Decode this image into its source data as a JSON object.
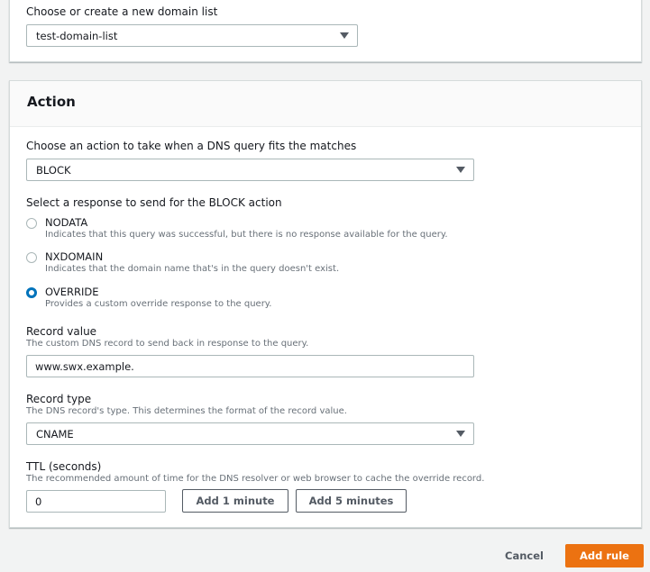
{
  "domain_list": {
    "label": "Choose or create a new domain list",
    "selected": "test-domain-list"
  },
  "action": {
    "title": "Action",
    "choose_label": "Choose an action to take when a DNS query fits the matches",
    "selected_action": "BLOCK",
    "response_label": "Select a response to send for the BLOCK action",
    "responses": [
      {
        "label": "NODATA",
        "description": "Indicates that this query was successful, but there is no response available for the query.",
        "checked": false
      },
      {
        "label": "NXDOMAIN",
        "description": "Indicates that the domain name that's in the query doesn't exist.",
        "checked": false
      },
      {
        "label": "OVERRIDE",
        "description": "Provides a custom override response to the query.",
        "checked": true
      }
    ],
    "record_value": {
      "label": "Record value",
      "description": "The custom DNS record to send back in response to the query.",
      "value": "www.swx.example."
    },
    "record_type": {
      "label": "Record type",
      "description": "The DNS record's type. This determines the format of the record value.",
      "selected": "CNAME"
    },
    "ttl": {
      "label": "TTL (seconds)",
      "description": "The recommended amount of time for the DNS resolver or web browser to cache the override record.",
      "value": "0",
      "add_1_minute": "Add 1 minute",
      "add_5_minutes": "Add 5 minutes"
    }
  },
  "footer": {
    "cancel": "Cancel",
    "add_rule": "Add rule"
  },
  "colors": {
    "primary": "#ec7211",
    "radio_checked": "#0073bb",
    "page_bg": "#f2f3f3"
  }
}
